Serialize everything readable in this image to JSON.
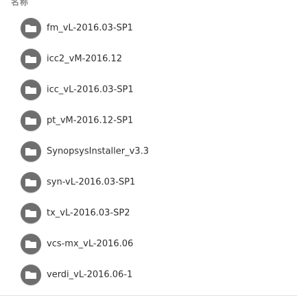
{
  "header": {
    "name_column": "名称"
  },
  "files": [
    {
      "name": "fm_vL-2016.03-SP1",
      "icon": "folder-icon"
    },
    {
      "name": "icc2_vM-2016.12",
      "icon": "folder-icon"
    },
    {
      "name": "icc_vL-2016.03-SP1",
      "icon": "folder-icon"
    },
    {
      "name": "pt_vM-2016.12-SP1",
      "icon": "folder-icon"
    },
    {
      "name": "SynopsysInstaller_v3.3",
      "icon": "folder-icon"
    },
    {
      "name": "syn-vL-2016.03-SP1",
      "icon": "folder-icon"
    },
    {
      "name": "tx_vL-2016.03-SP2",
      "icon": "folder-icon"
    },
    {
      "name": "vcs-mx_vL-2016.06",
      "icon": "folder-icon"
    },
    {
      "name": "verdi_vL-2016.06-1",
      "icon": "folder-icon"
    }
  ],
  "colors": {
    "icon_bg": "#6e6e6e",
    "folder_glyph": "#ffffff",
    "text": "#2e2e2e"
  }
}
